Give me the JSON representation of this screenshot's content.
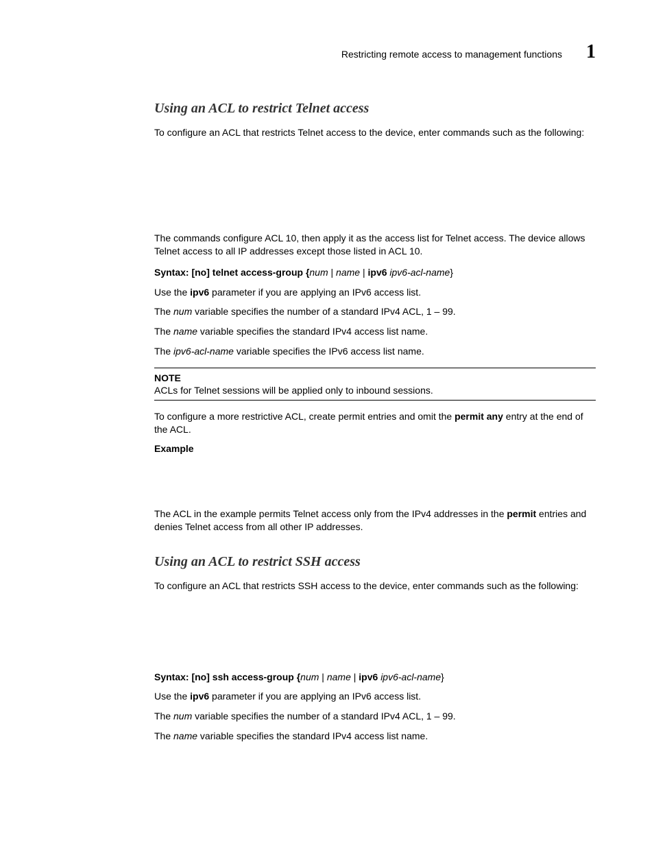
{
  "header": {
    "title": "Restricting remote access to management functions",
    "chapter": "1"
  },
  "sec1": {
    "heading": "Using an ACL to restrict Telnet access",
    "intro": "To configure an ACL that restricts Telnet access to the device, enter commands such as the following:",
    "desc": "The commands configure ACL 10, then apply it as the access list for Telnet access. The device allows Telnet access to all IP addresses except those listed in ACL 10.",
    "syntax": {
      "label": "Syntax: ",
      "cmd_prefix": "[no] telnet access-group {",
      "num": "num",
      "sep1": " | ",
      "name": "name",
      "sep2": " | ",
      "ipv6kw": "ipv6",
      "space": " ",
      "ipv6name": "ipv6-acl-name",
      "end": "}"
    },
    "ipv6line": {
      "pre": "Use the ",
      "kw": "ipv6",
      "post": " parameter if you are applying an IPv6 access list."
    },
    "numline": {
      "pre": "The ",
      "var": "num",
      "post": " variable specifies the number of a standard IPv4 ACL, 1 – 99."
    },
    "nameline": {
      "pre": "The ",
      "var": "name",
      "post": " variable specifies the standard IPv4 access list name."
    },
    "ipv6nameline": {
      "pre": "The ",
      "var": "ipv6-acl-name",
      "post": " variable specifies the IPv6 access list name."
    },
    "note": {
      "title": "NOTE",
      "body": "ACLs for Telnet sessions will be applied only to inbound sessions."
    },
    "permit": {
      "pre": "To configure a more restrictive ACL, create permit entries and omit the ",
      "kw": "permit any",
      "post": " entry at the end of the ACL."
    },
    "example_label": "Example",
    "example_desc": {
      "pre": "The ACL in the example permits Telnet access only from the IPv4 addresses in the ",
      "kw": "permit",
      "post": " entries and denies Telnet access from all other IP addresses."
    }
  },
  "sec2": {
    "heading": "Using an ACL to restrict SSH access",
    "intro": "To configure an ACL that restricts SSH access to the device, enter commands such as the following:",
    "syntax": {
      "label": "Syntax: ",
      "cmd_prefix": "[no] ssh access-group {",
      "num": "num",
      "sep1": " | ",
      "name": "name",
      "sep2": " | ",
      "ipv6kw": "ipv6",
      "space": " ",
      "ipv6name": "ipv6-acl-name",
      "end": "}"
    },
    "ipv6line": {
      "pre": "Use the ",
      "kw": "ipv6",
      "post": " parameter if you are applying an IPv6 access list."
    },
    "numline": {
      "pre": "The ",
      "var": "num",
      "post": " variable specifies the number of a standard IPv4 ACL, 1 – 99."
    },
    "nameline": {
      "pre": "The ",
      "var": "name",
      "post": " variable specifies the standard IPv4 access list name."
    }
  }
}
